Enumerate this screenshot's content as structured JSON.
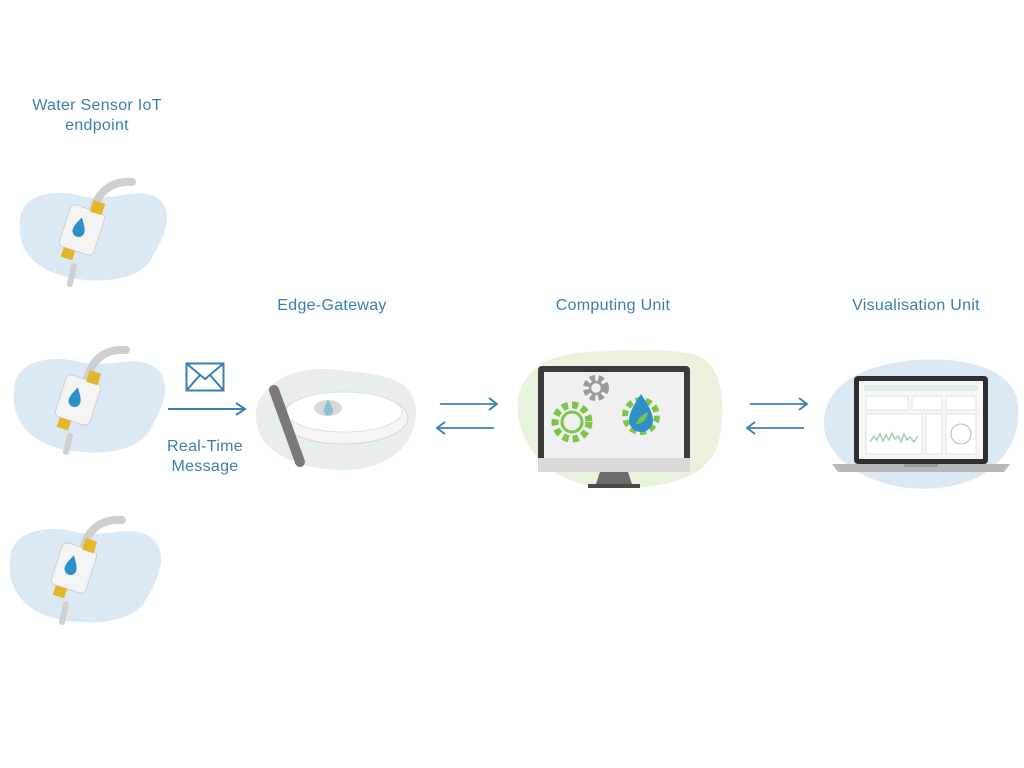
{
  "diagram": {
    "sensor_label": "Water Sensor IoT endpoint",
    "gateway_label": "Edge-Gateway",
    "computing_label": "Computing Unit",
    "visualisation_label": "Visualisation Unit",
    "message_label": "Real-Time Message"
  },
  "colors": {
    "label_text": "#3a7fb0",
    "arrow": "#3a7fb0",
    "sensor_blob": "#dbe9f5",
    "gateway_blob": "#e8efe9",
    "computing_blob": "#e9f2dc",
    "laptop_blob": "#dbe9f5",
    "sensor_yellow": "#e5b52a",
    "gear_green": "#7cc44a",
    "drop_blue": "#2f8fc8"
  },
  "icons": {
    "message": "envelope-icon",
    "sensor": "water-sensor-icon",
    "gateway": "router-antenna-icon",
    "computer": "monitor-icon",
    "laptop": "laptop-icon"
  }
}
